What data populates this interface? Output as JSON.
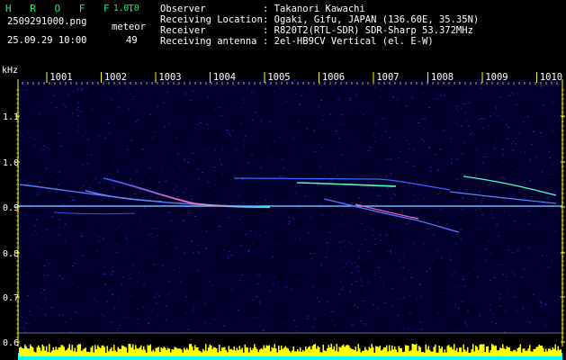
{
  "app": {
    "name": "H R O F F T",
    "version": "1.0.0"
  },
  "file": {
    "name": "2509291000.png",
    "datetime": "25.09.29 10:00"
  },
  "meteor": {
    "label": "meteor",
    "count": "49"
  },
  "info": [
    {
      "key": "Observer",
      "value": ": Takanori Kawachi"
    },
    {
      "key": "Receiving Location",
      "value": ": Ogaki, Gifu, JAPAN (136.60E, 35.35N)"
    },
    {
      "key": "Receiver",
      "value": ": R820T2(RTL-SDR) SDR-Sharp 53.372MHz"
    },
    {
      "key": "Receiving antenna",
      "value": ": 2el-HB9CV Vertical (el. E-W)"
    }
  ],
  "axis": {
    "unit": "kHz",
    "time_ticks": [
      "1001",
      "1002",
      "1003",
      "1004",
      "1005",
      "1006",
      "1007",
      "1008",
      "1009",
      "1010"
    ],
    "freq_ticks": [
      "1.1",
      "1.0",
      "0.9",
      "0.8",
      "0.7",
      "0.6"
    ]
  },
  "colors": {
    "text": "#ffffff",
    "title": "#00ff66",
    "tick": "#ffff00",
    "background": "#00002a",
    "level": "#ffff00",
    "level_base": "#00ffff"
  }
}
